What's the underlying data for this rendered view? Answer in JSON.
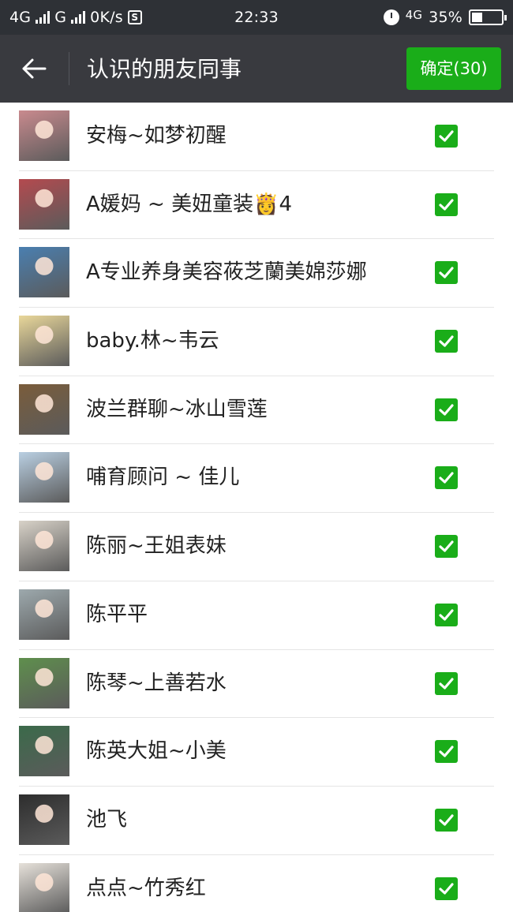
{
  "status_bar": {
    "left_text": "4G",
    "carrier2": "G",
    "speed": "0K/s",
    "s_icon": "S",
    "time": "22:33",
    "network": "4G",
    "battery_percent": "35%",
    "battery_level": 0.35
  },
  "header": {
    "title": "认识的朋友同事",
    "confirm_label": "确定(30)"
  },
  "contacts": [
    {
      "name": "安梅~如梦初醒",
      "checked": true,
      "avatar_color": "#c98a8e"
    },
    {
      "name": "A媛妈 ~ 美妞童装👸4",
      "checked": true,
      "avatar_color": "#b44a4f"
    },
    {
      "name": "A专业养身美容莜芝蘭美婂莎娜",
      "checked": true,
      "avatar_color": "#4a7fb0"
    },
    {
      "name": "baby.林~韦云",
      "checked": true,
      "avatar_color": "#e9d79a"
    },
    {
      "name": "波兰群聊~冰山雪莲",
      "checked": true,
      "avatar_color": "#7a5c3b"
    },
    {
      "name": "哺育顾问 ~ 佳儿",
      "checked": true,
      "avatar_color": "#b9cfe2"
    },
    {
      "name": "陈丽~王姐表妹",
      "checked": true,
      "avatar_color": "#d8d2c8"
    },
    {
      "name": "陈平平",
      "checked": true,
      "avatar_color": "#9da9ad"
    },
    {
      "name": "陈琴~上善若水",
      "checked": true,
      "avatar_color": "#5f8f4d"
    },
    {
      "name": "陈英大姐~小美",
      "checked": true,
      "avatar_color": "#3b6a4a"
    },
    {
      "name": "池飞",
      "checked": true,
      "avatar_color": "#2d2d2d"
    },
    {
      "name": "点点~竹秀红",
      "checked": true,
      "avatar_color": "#e6e1da"
    }
  ],
  "colors": {
    "accent": "#1aad19",
    "status_bg": "#2e3136",
    "title_bg": "#393a3f"
  }
}
